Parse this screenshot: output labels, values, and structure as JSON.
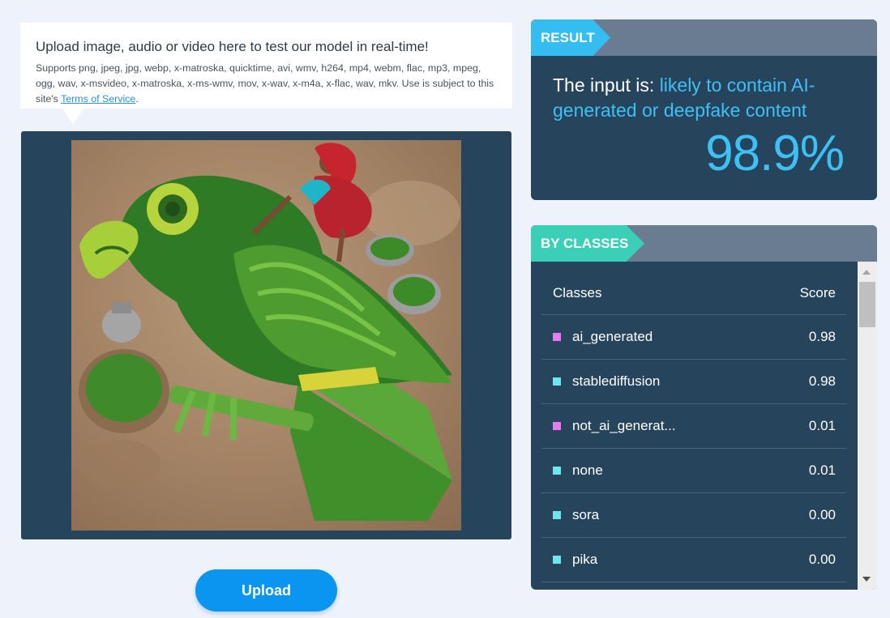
{
  "upload": {
    "title": "Upload image, audio or video here to test our model in real-time!",
    "description_prefix": "Supports png, jpeg, jpg, webp, x-matroska, quicktime, avi, wmv, h264, mp4, webm, flac, mp3, mpeg, ogg, wav, x-msvideo, x-matroska, x-ms-wmv, mov, x-wav, x-m4a, x-flac, wav, mkv. Use is subject to this site's ",
    "terms_link": "Terms of Service",
    "description_suffix": ".",
    "button_label": "Upload"
  },
  "image": {
    "description_icon": "parrot-made-of-green-chilies-photo"
  },
  "result": {
    "header": "RESULT",
    "prefix": "The input is: ",
    "verdict": "likely to contain AI-generated or deepfake content",
    "score": "98.9%"
  },
  "classes": {
    "header": "BY CLASSES",
    "col_class": "Classes",
    "col_score": "Score",
    "rows": [
      {
        "name": "ai_generated",
        "score": "0.98",
        "color": "#e77bf1"
      },
      {
        "name": "stablediffusion",
        "score": "0.98",
        "color": "#6ee7ea"
      },
      {
        "name": "not_ai_generat...",
        "score": "0.01",
        "color": "#e77bf1"
      },
      {
        "name": "none",
        "score": "0.01",
        "color": "#6ee7ea"
      },
      {
        "name": "sora",
        "score": "0.00",
        "color": "#6ee7ea"
      },
      {
        "name": "pika",
        "score": "0.00",
        "color": "#6ee7ea"
      }
    ]
  },
  "colors": {
    "accent_blue": "#35bdf2",
    "accent_teal": "#3ccfb7",
    "card_bg": "#27445d",
    "button": "#0a96f0"
  }
}
